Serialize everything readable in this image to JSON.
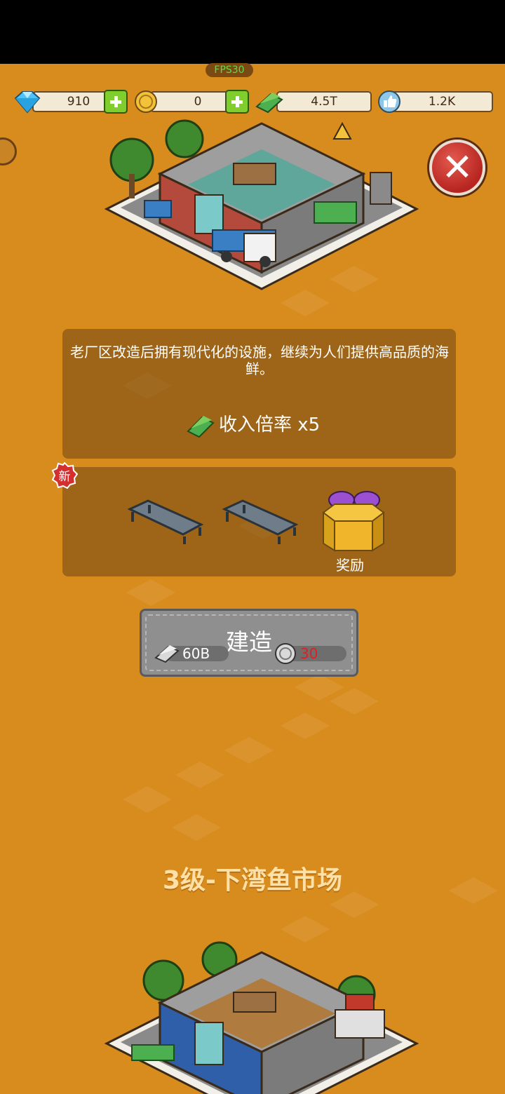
{
  "status": {
    "fps": "FPS30"
  },
  "resources": {
    "gems": "910",
    "coins": "0",
    "cash": "4.5T",
    "likes": "1.2K"
  },
  "card": {
    "description": "老厂区改造后拥有现代化的设施，继续为人们提供高品质的海鲜。",
    "income_label": "收入倍率",
    "income_value": "x5"
  },
  "rewards": {
    "new_badge": "新",
    "items": [
      "conveyor-table-icon",
      "conveyor-table-icon",
      "gift-box-icon"
    ],
    "gift_label": "奖励"
  },
  "build": {
    "label": "建造",
    "cash_cost": "60B",
    "coin_cost": "30",
    "coin_cost_color": "#e02020"
  },
  "next_level": {
    "title": "3级-下湾鱼市场"
  },
  "colors": {
    "background": "#d98c1e",
    "plus": "#7fce2e",
    "close": "#c0302a"
  }
}
